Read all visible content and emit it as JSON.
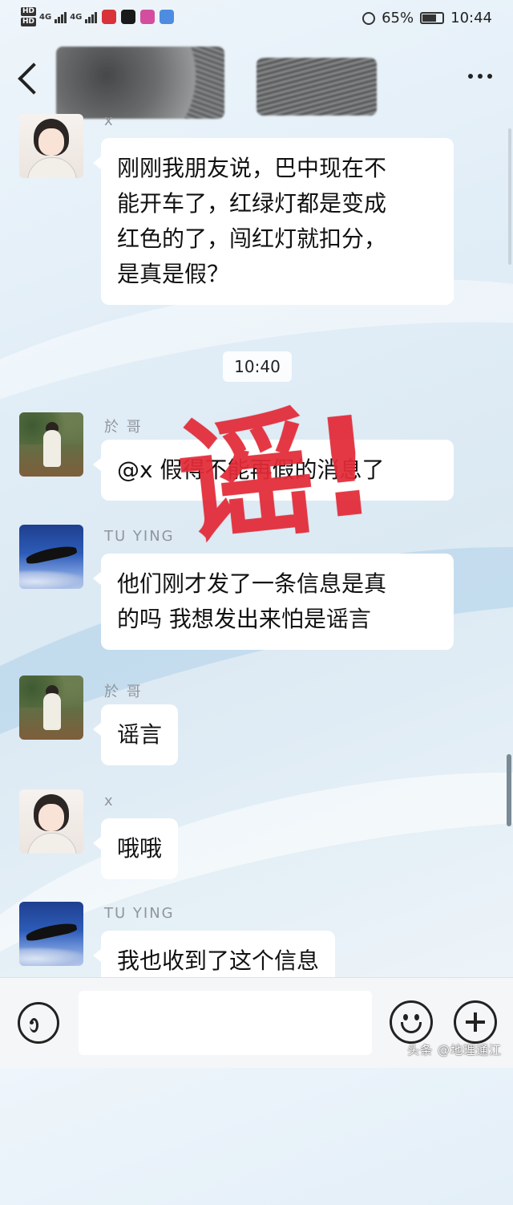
{
  "status_bar": {
    "hd1": "HD",
    "hd2": "HD",
    "net1": "4G",
    "net2": "4G",
    "battery": "65%",
    "time": "10:44",
    "app_icon_colors": [
      "#d8333a",
      "#1a1a1a",
      "#d44ea0",
      "#4d8ce0"
    ]
  },
  "messages": [
    {
      "sender": "x",
      "avatar": "girl-avatar",
      "text_lines": [
        "刚刚我朋友说，巴中现在不",
        "能开车了，红绿灯都是变成",
        "红色的了，闯红灯就扣分，",
        "是真是假？"
      ]
    },
    {
      "sender": "於 哥",
      "avatar": "boy-avatar",
      "text_lines": [
        "@x  假得不能再假的消息了"
      ]
    },
    {
      "sender": "TU    YING",
      "avatar": "eagle-avatar",
      "text_lines": [
        "他们刚才发了一条信息是真",
        "的吗 我想发出来怕是谣言"
      ]
    },
    {
      "sender": "於 哥",
      "avatar": "boy-avatar",
      "text_lines": [
        "谣言"
      ]
    },
    {
      "sender": "x",
      "avatar": "girl-avatar",
      "text_lines": [
        "哦哦"
      ]
    },
    {
      "sender": "TU    YING",
      "avatar": "eagle-avatar",
      "text_lines": [
        "我也收到了这个信息"
      ]
    }
  ],
  "timestamp": "10:40",
  "stamp_text": "谣!",
  "stamp_color": "#e42c3a",
  "input": {
    "value": "",
    "placeholder": ""
  },
  "watermark": "头条 @地理通江",
  "colors": {
    "bubble": "#ffffff",
    "sender": "#8f969c",
    "background": "#e2eef7"
  }
}
